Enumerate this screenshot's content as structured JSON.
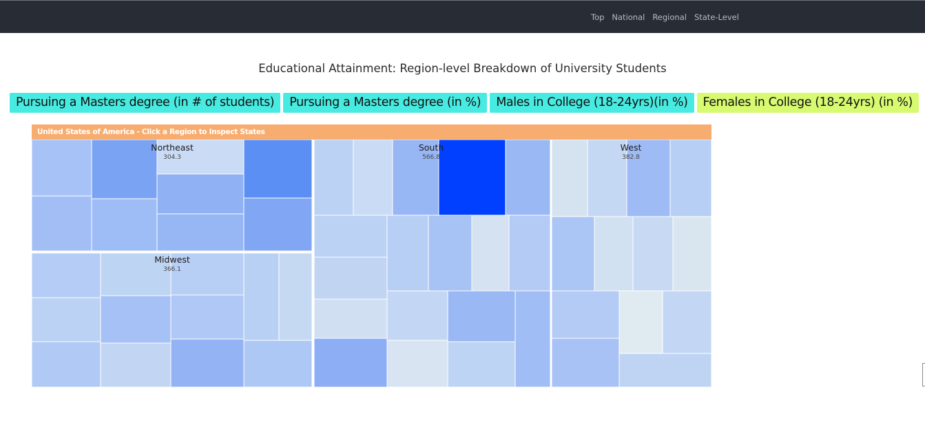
{
  "nav": {
    "links": [
      "Top",
      "National",
      "Regional",
      "State-Level"
    ]
  },
  "page": {
    "title": "Educational Attainment: Region-level Breakdown of University Students"
  },
  "metric_buttons": [
    {
      "label": "Pursuing a Masters degree (in # of students)",
      "color": "#48ebe1"
    },
    {
      "label": "Pursuing a Masters degree (in %)",
      "color": "#48ebe1"
    },
    {
      "label": "Males in College (18-24yrs)(in %)",
      "color": "#48ebe1"
    },
    {
      "label": "Females in College (18-24yrs) (in %)",
      "color": "#d7fa70",
      "selected": true
    }
  ],
  "treemap": {
    "header": "United States of America - Click a Region to Inspect States",
    "header_color": "#f8ad70",
    "regions": [
      {
        "name": "Northeast",
        "value": "304.3",
        "state_count": 9
      },
      {
        "name": "South",
        "value": "566.8",
        "state_count": 17
      },
      {
        "name": "West",
        "value": "382.8",
        "state_count": 13
      },
      {
        "name": "Midwest",
        "value": "366.1",
        "state_count": 12
      }
    ]
  }
}
